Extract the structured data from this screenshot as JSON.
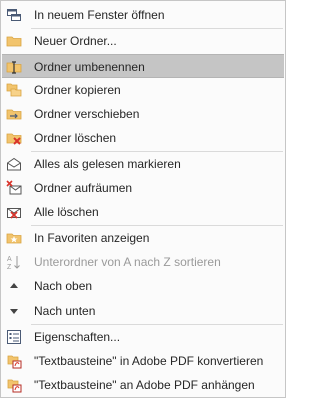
{
  "menu": {
    "items": [
      {
        "label": "In neuem Fenster öffnen",
        "icon": "new-window-icon"
      },
      {
        "label": "Neuer Ordner...",
        "icon": "folder-icon"
      },
      {
        "label": "Ordner umbenennen",
        "icon": "folder-rename-icon",
        "highlighted": true
      },
      {
        "label": "Ordner kopieren",
        "icon": "folder-copy-icon"
      },
      {
        "label": "Ordner verschieben",
        "icon": "folder-move-icon"
      },
      {
        "label": "Ordner löschen",
        "icon": "folder-delete-icon"
      },
      {
        "label": "Alles als gelesen markieren",
        "icon": "mark-read-icon"
      },
      {
        "label": "Ordner aufräumen",
        "icon": "cleanup-folder-icon"
      },
      {
        "label": "Alle löschen",
        "icon": "delete-all-icon"
      },
      {
        "label": "In Favoriten anzeigen",
        "icon": "favorites-folder-icon"
      },
      {
        "label": "Unterordner von A nach Z sortieren",
        "icon": "sort-az-icon",
        "disabled": true
      },
      {
        "label": "Nach oben",
        "icon": "arrow-up-icon"
      },
      {
        "label": "Nach unten",
        "icon": "arrow-down-icon"
      },
      {
        "label": "Eigenschaften...",
        "icon": "properties-icon"
      },
      {
        "label": "\"Textbausteine\" in Adobe PDF konvertieren",
        "icon": "pdf-convert-icon"
      },
      {
        "label": "\"Textbausteine\" an Adobe PDF anhängen",
        "icon": "pdf-append-icon"
      }
    ]
  },
  "colors": {
    "highlight": "#c5c5c5",
    "folder": "#f2c46d",
    "delete_red": "#d9342b",
    "disabled_text": "#9a9a9a"
  }
}
